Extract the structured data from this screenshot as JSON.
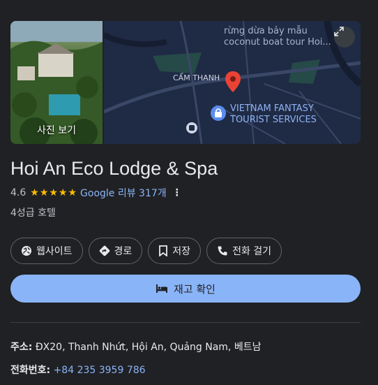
{
  "photo": {
    "label": "사진 보기"
  },
  "map": {
    "labels": {
      "area": "CẨM THANH",
      "boat1": "rừng dừa bảy mẫu",
      "boat2": "coconut boat tour Hoi...",
      "poi1": "VIETNAM FANTASY",
      "poi2": "TOURIST SERVICES"
    },
    "colors": {
      "water": "#1f2a44",
      "road": "#3a4766",
      "green": "#254a48",
      "pin": "#ea4335",
      "poi": "#5a8dee"
    }
  },
  "place": {
    "name": "Hoi An Eco Lodge & Spa",
    "rating": "4.6",
    "stars": "★★★★★",
    "reviews": "Google 리뷰 317개",
    "more": "⋮",
    "category": "4성급 호텔"
  },
  "actions": {
    "website": "웹사이트",
    "directions": "경로",
    "save": "저장",
    "call": "전화 걸기"
  },
  "primary": {
    "label": "재고 확인"
  },
  "info": {
    "address_label": "주소:",
    "address_value": "ĐX20, Thanh Nhứt, Hội An, Quảng Nam, 베트남",
    "phone_label": "전화번호:",
    "phone_value": "+84 235 3959 786"
  },
  "colors": {
    "background": "#202124",
    "accent": "#8ab4f8",
    "star": "#fbbc04"
  }
}
